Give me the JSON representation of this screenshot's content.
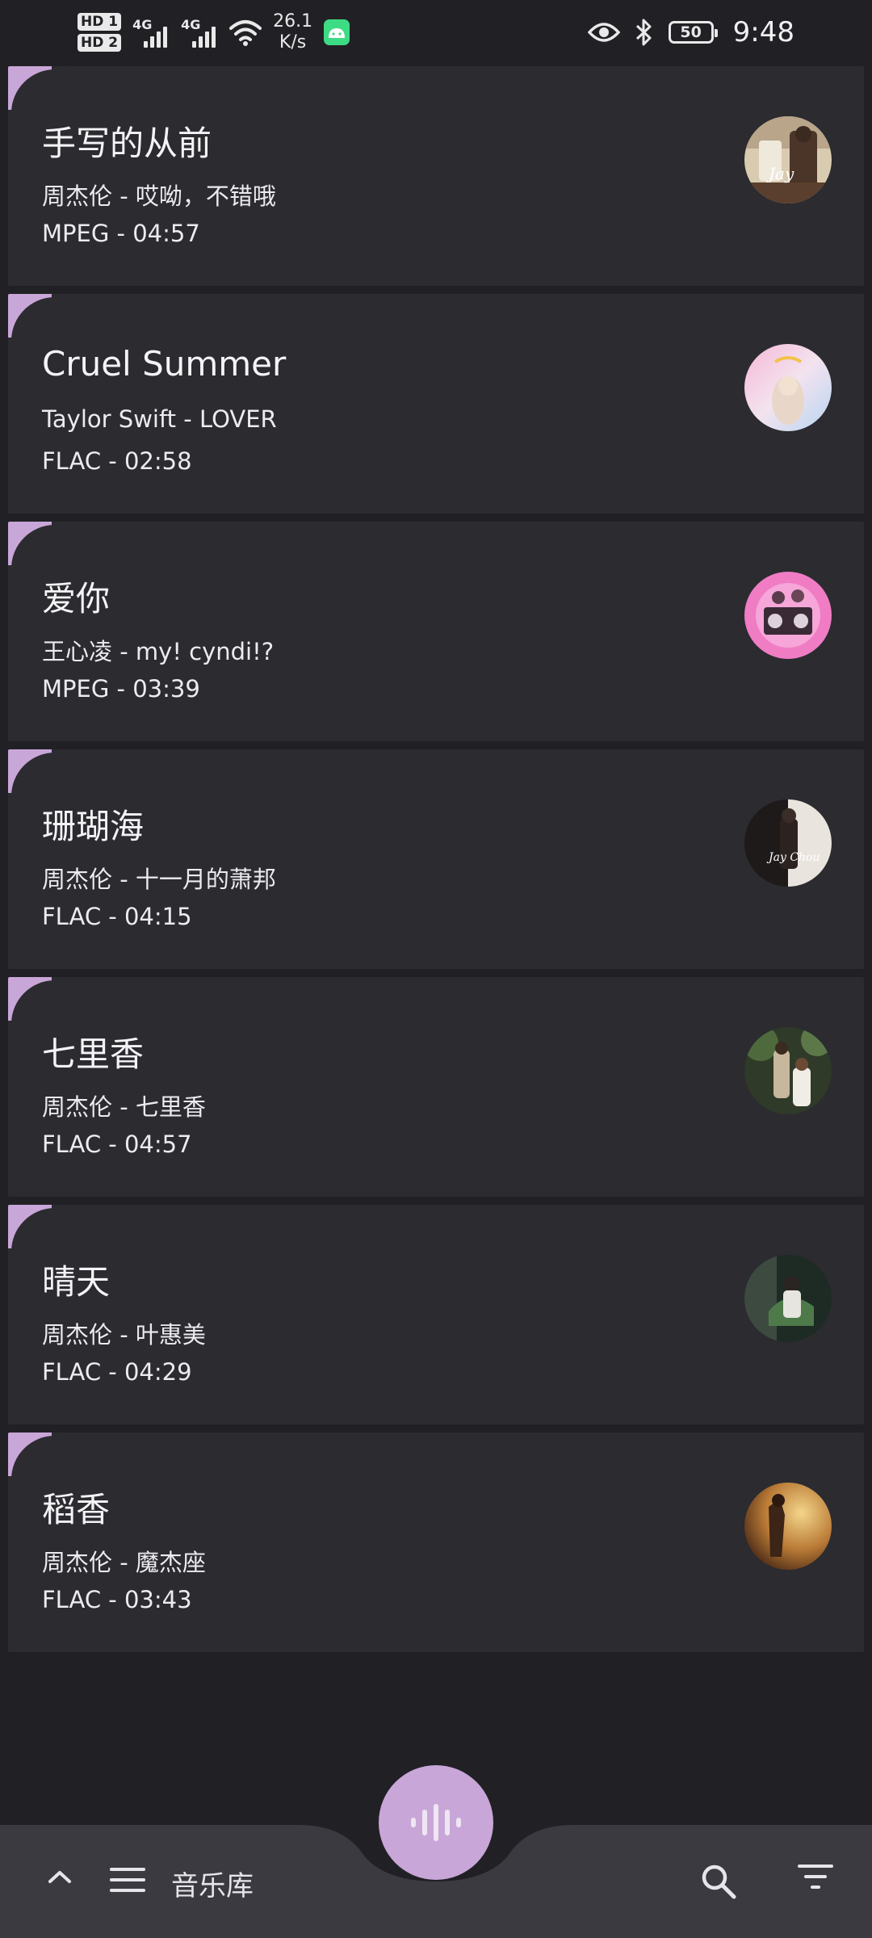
{
  "status_bar": {
    "sim1_label": "HD 1",
    "sim2_label": "HD 2",
    "network1": "4G",
    "network2": "4G",
    "speed_value": "26.1",
    "speed_unit": "K/s",
    "battery": "50",
    "time": "9:48"
  },
  "tracks": [
    {
      "title": "手写的从前",
      "subtitle": "周杰伦 - 哎呦，不错哦",
      "meta": "MPEG - 04:57"
    },
    {
      "title": "Cruel Summer",
      "subtitle": "Taylor Swift - LOVER",
      "meta": "FLAC - 02:58"
    },
    {
      "title": "爱你",
      "subtitle": "王心凌 - my! cyndi!?",
      "meta": "MPEG - 03:39"
    },
    {
      "title": "珊瑚海",
      "subtitle": "周杰伦 - 十一月的萧邦",
      "meta": "FLAC - 04:15"
    },
    {
      "title": "七里香",
      "subtitle": "周杰伦 - 七里香",
      "meta": "FLAC - 04:57"
    },
    {
      "title": "晴天",
      "subtitle": "周杰伦 - 叶惠美",
      "meta": "FLAC - 04:29"
    },
    {
      "title": "稻香",
      "subtitle": "周杰伦 - 魔杰座",
      "meta": "FLAC - 03:43"
    }
  ],
  "bottom_bar": {
    "title": "音乐库",
    "icons": [
      "expand-less-icon",
      "menu-icon",
      "search-icon",
      "filter-icon",
      "waveform-icon"
    ]
  },
  "colors": {
    "background": "#212125",
    "card": "#2b2b30",
    "accent": "#c9a6d8",
    "bottom_bar": "#3a3a40"
  }
}
